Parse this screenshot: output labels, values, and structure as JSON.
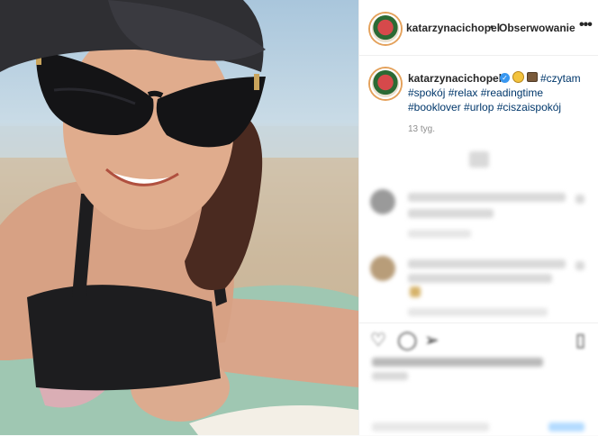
{
  "post": {
    "username": "katarzynacichopel",
    "follow_label": "Obserwowanie",
    "more_label": "•••",
    "separator": "•",
    "caption": {
      "username": "katarzynacichopek",
      "tag_line1": "#czytam",
      "tag_line2": "#spokój #relax #readingtime",
      "tag_line3": "#booklover #urlop #ciszaispokój"
    },
    "time_ago": "13 tyg."
  },
  "colors": {
    "hashtag": "#00376b",
    "verified": "#3897f0",
    "text": "#262626",
    "muted": "#8e8e8e"
  },
  "icons": [
    "verified-badge-icon",
    "sun-emoji-icon",
    "book-emoji-icon",
    "more-options-icon",
    "heart-icon",
    "comment-icon",
    "share-icon",
    "bookmark-icon"
  ]
}
